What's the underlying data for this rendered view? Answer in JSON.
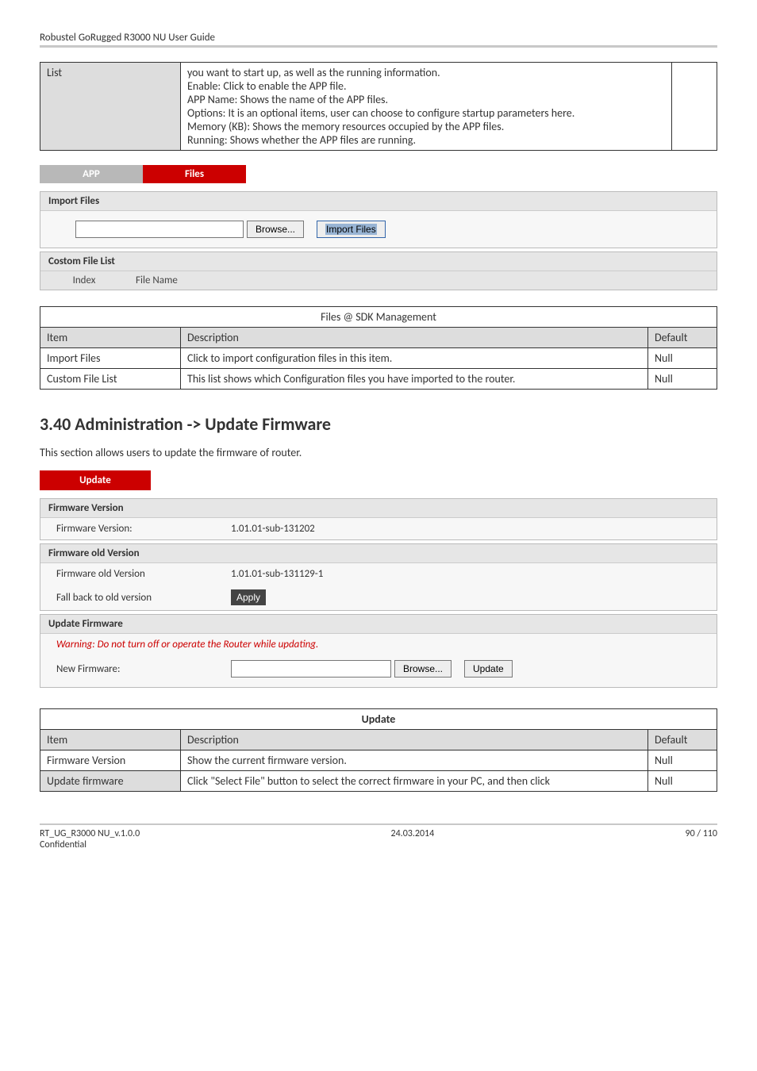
{
  "header": {
    "title": "Robustel GoRugged R3000 NU User Guide"
  },
  "listTable": {
    "col1": "List",
    "lines": [
      "you want to start up, as well as the running information.",
      "Enable: Click to enable the APP file.",
      "APP Name: Shows the name of the APP files.",
      "Options: It is an optional items, user can choose to configure startup parameters here.",
      "Memory (KB): Shows the memory resources occupied by the APP files.",
      "Running: Shows whether the APP files are running."
    ]
  },
  "tabs1": {
    "app": "APP",
    "files": "Files"
  },
  "importFiles": {
    "header": "Import Files",
    "browse": "Browse...",
    "importBtn": "Import Files"
  },
  "customList": {
    "header": "Costom File List",
    "indexLabel": "Index",
    "filenameLabel": "File Name"
  },
  "filesTable": {
    "title": "Files @ SDK Management",
    "hItem": "Item",
    "hDesc": "Description",
    "hDefault": "Default",
    "rows": [
      {
        "item": "Import Files",
        "desc": "Click to import configuration files in this item.",
        "def": "Null"
      },
      {
        "item": "Custom File List",
        "desc": "This list shows which Configuration files you have imported to the router.",
        "def": "Null"
      }
    ]
  },
  "section": {
    "heading": "3.40  Administration -> Update Firmware",
    "desc": "This section allows users to update the firmware of router."
  },
  "updateTab": "Update",
  "fwVersion": {
    "header": "Firmware Version",
    "label": "Firmware Version:",
    "value": "1.01.01-sub-131202"
  },
  "fwOld": {
    "header": "Firmware old Version",
    "label1": "Firmware old Version",
    "value1": "1.01.01-sub-131129-1",
    "label2": "Fall back to old version",
    "apply": "Apply"
  },
  "updateFw": {
    "header": "Update Firmware",
    "warning": "Warning: Do not turn off or operate the Router while updating.",
    "newFwLabel": "New Firmware:",
    "browse": "Browse...",
    "update": "Update"
  },
  "updateTable": {
    "title": "Update",
    "hItem": "Item",
    "hDesc": "Description",
    "hDefault": "Default",
    "rows": [
      {
        "item": "Firmware Version",
        "desc": "Show the current firmware version.",
        "def": "Null"
      },
      {
        "item": "Update firmware",
        "desc": "Click \"Select File\" button to select the correct firmware in your PC, and then click",
        "def": "Null"
      }
    ]
  },
  "footer": {
    "left1": "RT_UG_R3000 NU_v.1.0.0",
    "left2": "Confidential",
    "center": "24.03.2014",
    "right": "90 / 110"
  }
}
